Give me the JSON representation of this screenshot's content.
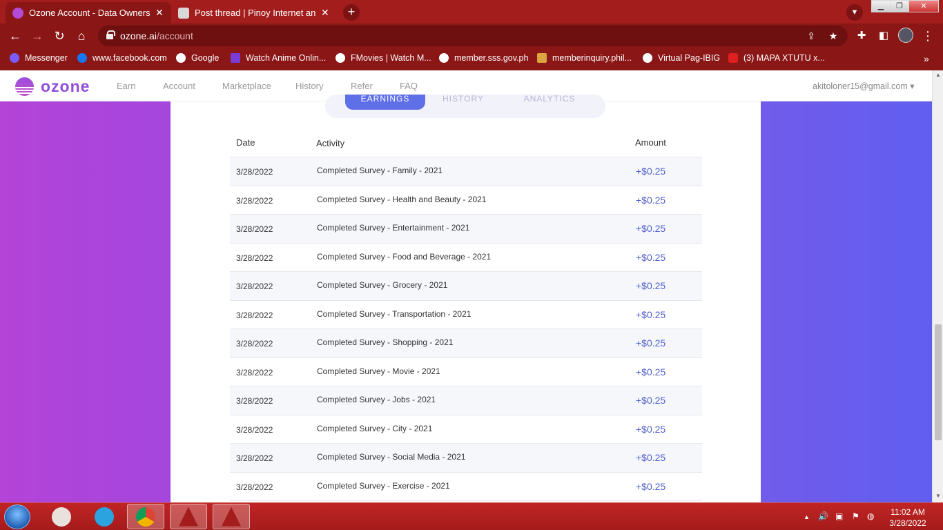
{
  "browser": {
    "tabs": [
      {
        "title": "Ozone Account - Data Ownership",
        "active": true
      },
      {
        "title": "Post thread | Pinoy Internet and T",
        "active": false
      }
    ],
    "url_domain": "ozone.ai",
    "url_path": "/account",
    "bookmarks": [
      "Messenger",
      "www.facebook.com",
      "Google",
      "Watch Anime Onlin...",
      "FMovies | Watch M...",
      "member.sss.gov.ph",
      "memberinquiry.phil...",
      "Virtual Pag-IBIG",
      "(3) MAPA XTUTU x..."
    ]
  },
  "site": {
    "logo": "ozone",
    "nav": [
      "Earn",
      "Account",
      "Marketplace",
      "History",
      "Refer",
      "FAQ"
    ],
    "account_email": "akitoloner15@gmail.com"
  },
  "segment_tabs": [
    "EARNINGS",
    "HISTORY",
    "ANALYTICS"
  ],
  "table": {
    "headers": {
      "date": "Date",
      "activity": "Activity",
      "amount": "Amount"
    },
    "rows": [
      {
        "date": "3/28/2022",
        "activity": "Completed Survey - Family - 2021",
        "amount": "+$0.25"
      },
      {
        "date": "3/28/2022",
        "activity": "Completed Survey - Health and Beauty - 2021",
        "amount": "+$0.25"
      },
      {
        "date": "3/28/2022",
        "activity": "Completed Survey - Entertainment - 2021",
        "amount": "+$0.25"
      },
      {
        "date": "3/28/2022",
        "activity": "Completed Survey - Food and Beverage - 2021",
        "amount": "+$0.25"
      },
      {
        "date": "3/28/2022",
        "activity": "Completed Survey - Grocery - 2021",
        "amount": "+$0.25"
      },
      {
        "date": "3/28/2022",
        "activity": "Completed Survey - Transportation - 2021",
        "amount": "+$0.25"
      },
      {
        "date": "3/28/2022",
        "activity": "Completed Survey - Shopping - 2021",
        "amount": "+$0.25"
      },
      {
        "date": "3/28/2022",
        "activity": "Completed Survey - Movie - 2021",
        "amount": "+$0.25"
      },
      {
        "date": "3/28/2022",
        "activity": "Completed Survey - Jobs - 2021",
        "amount": "+$0.25"
      },
      {
        "date": "3/28/2022",
        "activity": "Completed Survey - City - 2021",
        "amount": "+$0.25"
      },
      {
        "date": "3/28/2022",
        "activity": "Completed Survey - Social Media - 2021",
        "amount": "+$0.25"
      },
      {
        "date": "3/28/2022",
        "activity": "Completed Survey - Exercise - 2021",
        "amount": "+$0.25"
      }
    ]
  },
  "taskbar": {
    "time": "11:02 AM",
    "date": "3/28/2022"
  },
  "colors": {
    "accent": "#5f6fe8",
    "amount": "#5360cc",
    "chrome": "#8a1616"
  }
}
